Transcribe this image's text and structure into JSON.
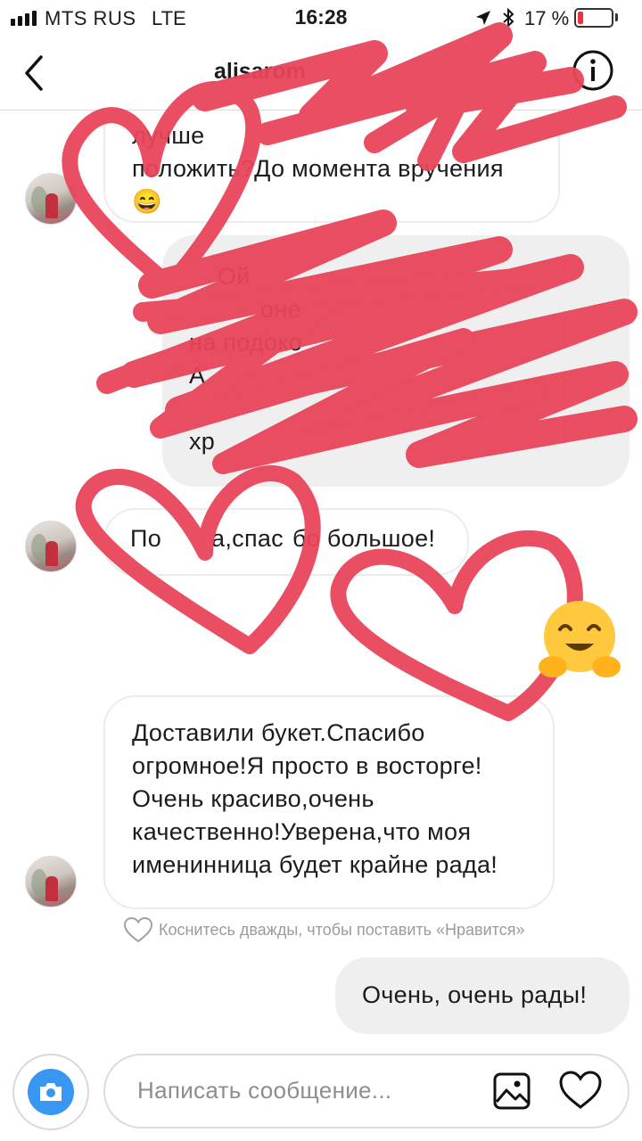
{
  "status_bar": {
    "carrier": "MTS RUS",
    "network": "LTE",
    "time": "16:28",
    "battery_percent": "17 %",
    "battery_level": 0.17
  },
  "header": {
    "username": "alisarom"
  },
  "messages": [
    {
      "direction": "incoming",
      "lines": [
        "лучше",
        "положить?До момента вручения"
      ],
      "emoji_tail": "😄"
    },
    {
      "direction": "outgoing",
      "lines": [
        "Ой",
        "оне",
        "на подоко",
        "А",
        "хр"
      ]
    },
    {
      "direction": "incoming",
      "lines": [
        "По",
        "а,спас",
        "бо большое!"
      ]
    },
    {
      "direction": "incoming",
      "lines": [
        "Доставили букет.Спасибо",
        "огромное!Я просто в восторге!",
        "Очень красиво,очень",
        "качественно!Уверена,что моя",
        "именинница будет крайне рада!"
      ]
    },
    {
      "direction": "outgoing",
      "lines": [
        "Очень, очень рады!"
      ]
    }
  ],
  "like_hint": "Коснитесь дважды, чтобы поставить «Нравится»",
  "composer": {
    "placeholder": "Написать сообщение..."
  },
  "colors": {
    "accent": "#3897f0",
    "scribble": "#e8455a",
    "bubble_out": "#efefef",
    "battery_low": "#e8353d"
  },
  "icons": [
    "signal-icon",
    "location-icon",
    "bluetooth-icon",
    "battery-icon",
    "back-icon",
    "info-icon",
    "camera-icon",
    "gallery-icon",
    "heart-icon",
    "hugging-face-emoji"
  ]
}
